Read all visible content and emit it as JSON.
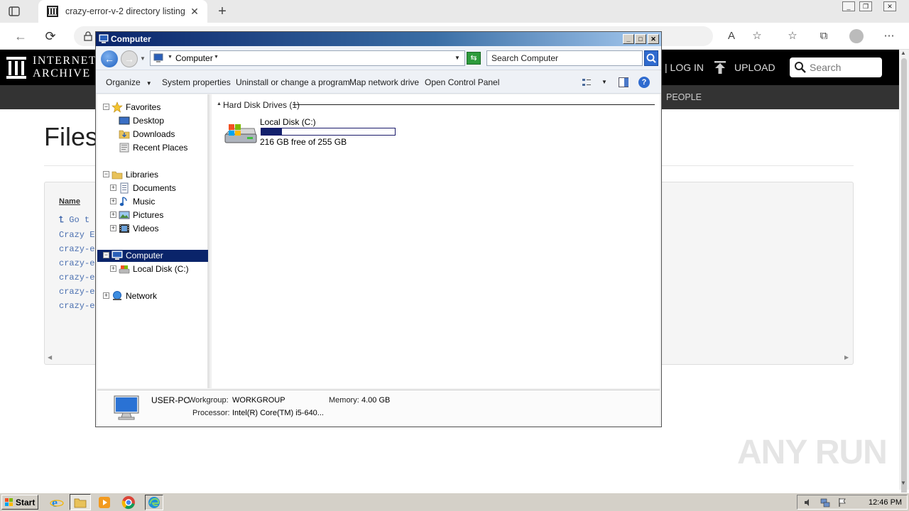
{
  "browser": {
    "tab_title": "crazy-error-v-2 directory listing",
    "tab_close": "✕",
    "new_tab": "+"
  },
  "archive": {
    "logo_line1": "INTERNET",
    "logo_line2": "ARCHIVE",
    "login": "| LOG IN",
    "upload": "UPLOAD",
    "search_placeholder": "Search",
    "subnav_people": "PEOPLE",
    "heading": "Files",
    "listing_name_header": "Name",
    "listing_rows": [
      "Go t",
      "Crazy E",
      "crazy-e",
      "crazy-e",
      "crazy-e",
      "crazy-e",
      "crazy-e"
    ]
  },
  "explorer": {
    "title": "Computer",
    "title_buttons": {
      "minimize": "_",
      "maximize": "□",
      "close": "✕"
    },
    "address_label": "Computer",
    "search_placeholder": "Search Computer",
    "commands": [
      "Organize",
      "System properties",
      "Uninstall or change a program",
      "Map network drive",
      "Open Control Panel"
    ],
    "nav_tree": {
      "favorites": "Favorites",
      "desktop": "Desktop",
      "downloads": "Downloads",
      "recent": "Recent Places",
      "libraries": "Libraries",
      "documents": "Documents",
      "music": "Music",
      "pictures": "Pictures",
      "videos": "Videos",
      "computer": "Computer",
      "local_disk": "Local Disk (C:)",
      "network": "Network"
    },
    "group_header": "Hard Disk Drives (1)",
    "drive": {
      "name": "Local Disk (C:)",
      "free_text": "216 GB free of 255 GB",
      "used_fraction": 0.153
    },
    "details": {
      "name": "USER-PC",
      "workgroup_label": "Workgroup:",
      "workgroup": "WORKGROUP",
      "memory_label": "Memory:",
      "memory": "4.00 GB",
      "processor_label": "Processor:",
      "processor": "Intel(R) Core(TM) i5-640..."
    }
  },
  "taskbar": {
    "start": "Start",
    "clock": "12:46 PM"
  },
  "watermark": "ANY RUN"
}
